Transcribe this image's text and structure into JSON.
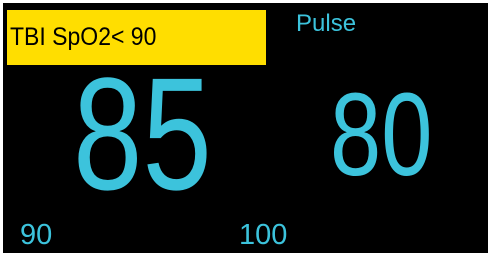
{
  "colors": {
    "background": "#000000",
    "value_text": "#3cc3dc",
    "alarm_background": "#ffde00",
    "alarm_text": "#000000"
  },
  "alarm": {
    "text": "TBI SpO2< 90"
  },
  "spo2": {
    "value": "85",
    "alarm_limit_low": "90",
    "alarm_limit_high": "100"
  },
  "pulse": {
    "label": "Pulse",
    "value": "80"
  }
}
